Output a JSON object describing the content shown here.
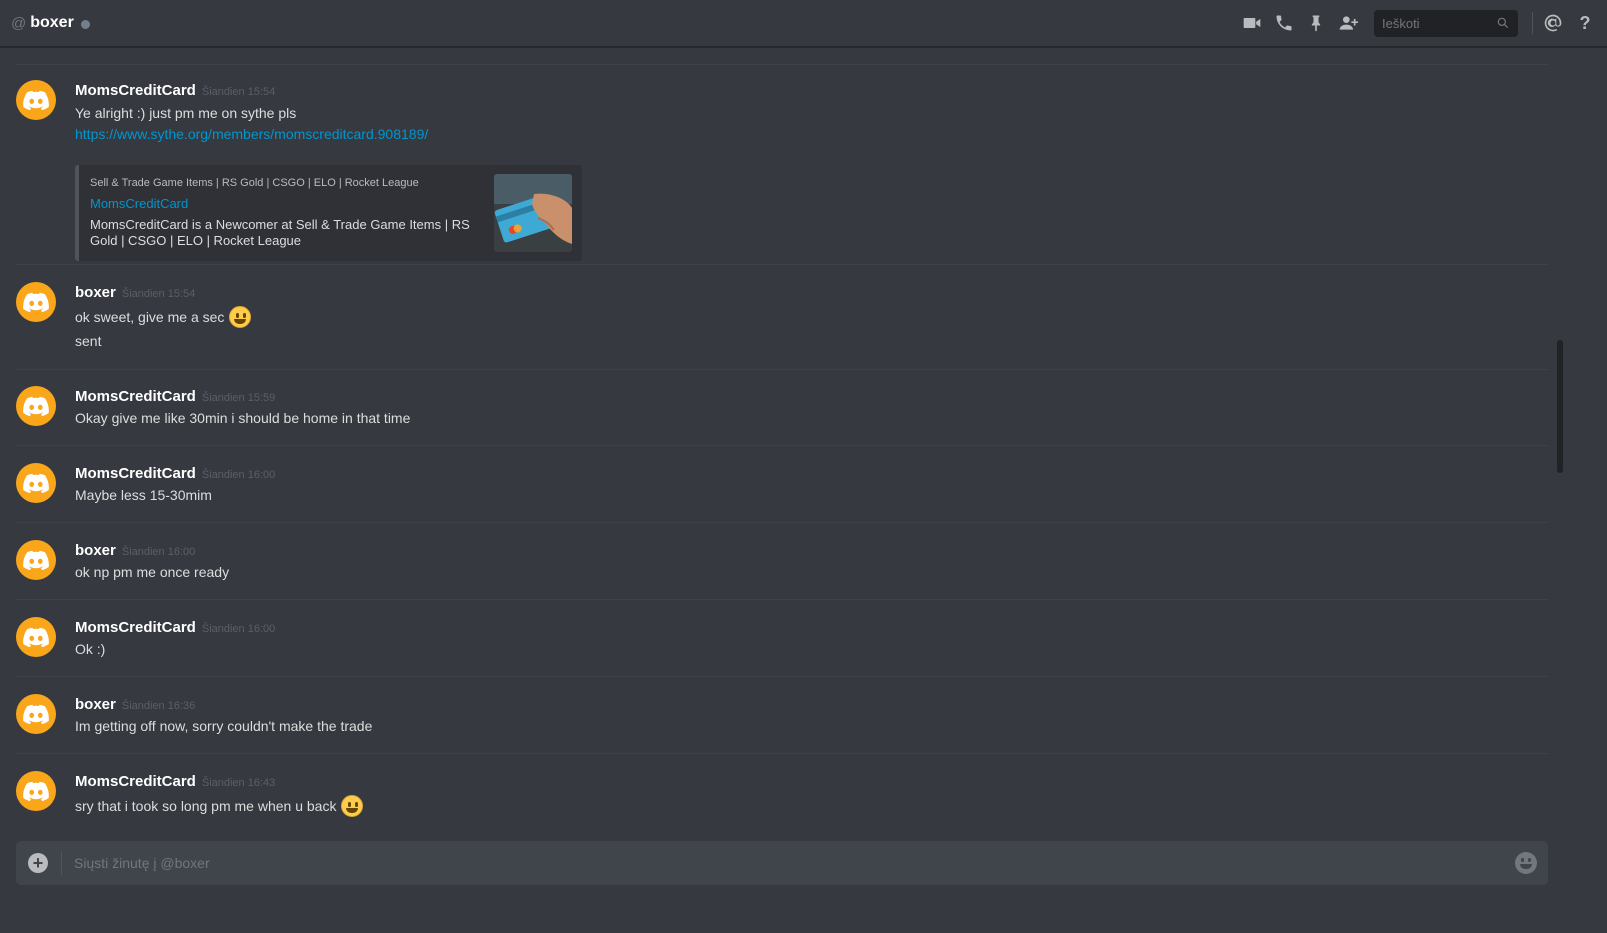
{
  "header": {
    "at_symbol": "@",
    "title": "boxer",
    "status_color": "#747f8d",
    "search_placeholder": "Ieškoti",
    "help_label": "?",
    "tools": [
      "video-call-icon",
      "voice-call-icon",
      "pin-icon",
      "add-friend-icon",
      "search-icon",
      "mention-icon",
      "help-icon"
    ]
  },
  "colors": {
    "background": "#36393f",
    "avatar": "#faa61a",
    "link": "#0096cf",
    "input_bg": "#40444b"
  },
  "messages": [
    {
      "author": "MomsCreditCard",
      "timestamp": "Šiandien 15:54",
      "lines": [
        "Ye alright :) just pm me on sythe pls",
        "https://www.sythe.org/members/momscreditcard.908189/"
      ],
      "embed": {
        "provider": "Sell & Trade Game Items | RS Gold | CSGO | ELO | Rocket League",
        "title": "MomsCreditCard",
        "description": "MomsCreditCard is a Newcomer at Sell & Trade Game Items | RS Gold | CSGO | ELO | Rocket League"
      }
    },
    {
      "author": "boxer",
      "timestamp": "Šiandien 15:54",
      "lines": [
        "ok sweet, give me a sec",
        "sent"
      ]
    },
    {
      "author": "MomsCreditCard",
      "timestamp": "Šiandien 15:59",
      "lines": [
        "Okay give me like 30min i should be home in that time"
      ]
    },
    {
      "author": "MomsCreditCard",
      "timestamp": "Šiandien 16:00",
      "lines": [
        "Maybe less 15-30mim"
      ]
    },
    {
      "author": "boxer",
      "timestamp": "Šiandien 16:00",
      "lines": [
        "ok np pm me once ready"
      ]
    },
    {
      "author": "MomsCreditCard",
      "timestamp": "Šiandien 16:00",
      "lines": [
        "Ok :)"
      ]
    },
    {
      "author": "boxer",
      "timestamp": "Šiandien 16:36",
      "lines": [
        "Im getting off now, sorry couldn't make the trade"
      ]
    },
    {
      "author": "MomsCreditCard",
      "timestamp": "Šiandien 16:43",
      "lines": [
        "sry that i took so long pm me when u back"
      ]
    }
  ],
  "composer": {
    "placeholder": "Siųsti žinutę į @boxer"
  }
}
